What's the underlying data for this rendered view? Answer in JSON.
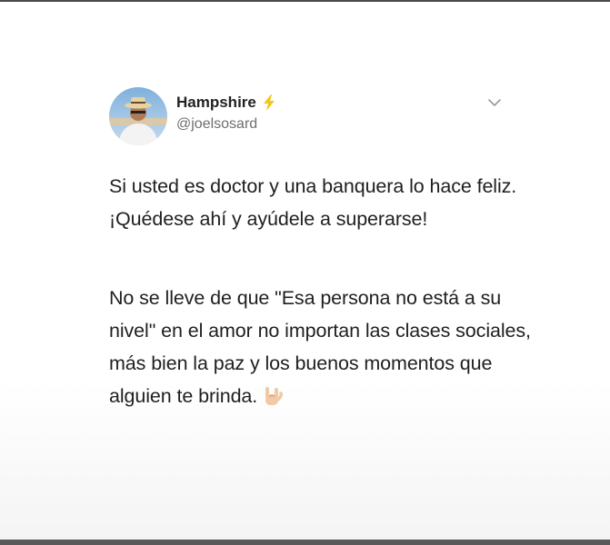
{
  "tweet": {
    "author": {
      "display_name": "Hampshire",
      "handle": "@joelsosard",
      "badge_icon": "lightning-bolt-icon",
      "badge_color": "#f5c518",
      "avatar_icon": "profile-photo"
    },
    "menu_icon": "chevron-down-icon",
    "paragraphs": [
      "Si usted es doctor y una banquera lo hace feliz. ¡Quédese ahí y ayúdele a superarse!",
      "No se lleve de que \"Esa persona no está a su nivel\" en el amor no importan las clases sociales, más bien la paz y los buenos momentos que alguien te brinda."
    ],
    "trailing_emoji": "sign-of-the-horns-emoji"
  }
}
